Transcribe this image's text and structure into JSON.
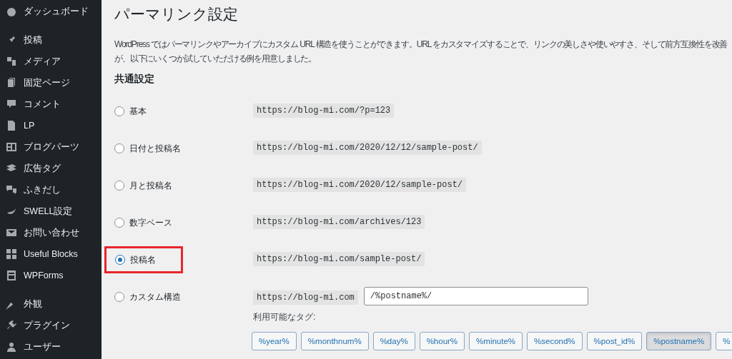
{
  "sidebar": {
    "groups": [
      {
        "items": [
          {
            "label": "ダッシュボード"
          }
        ]
      },
      {
        "items": [
          {
            "label": "投稿"
          },
          {
            "label": "メディア"
          },
          {
            "label": "固定ページ"
          },
          {
            "label": "コメント"
          },
          {
            "label": "LP"
          },
          {
            "label": "ブログパーツ"
          },
          {
            "label": "広告タグ"
          },
          {
            "label": "ふきだし"
          },
          {
            "label": "SWELL設定"
          },
          {
            "label": "お問い合わせ"
          },
          {
            "label": "Useful Blocks"
          },
          {
            "label": "WPForms"
          }
        ]
      },
      {
        "items": [
          {
            "label": "外観"
          },
          {
            "label": "プラグイン"
          },
          {
            "label": "ユーザー"
          }
        ]
      }
    ]
  },
  "page": {
    "title": "パーマリンク設定",
    "description_lines": [
      "WordPress ではパーマリンクやアーカイブにカスタム URL 構造を使うことができます。URL をカスタマイズすることで、リンクの美しさや使いやすさ、そして前方互換性を改善",
      "が、以下にいくつか試していただける例を用意しました。"
    ],
    "section_title": "共通設定",
    "options": [
      {
        "label": "基本",
        "url": "https://blog-mi.com/?p=123",
        "selected": false,
        "highlighted": false,
        "kind": "preset"
      },
      {
        "label": "日付と投稿名",
        "url": "https://blog-mi.com/2020/12/12/sample-post/",
        "selected": false,
        "highlighted": false,
        "kind": "preset"
      },
      {
        "label": "月と投稿名",
        "url": "https://blog-mi.com/2020/12/sample-post/",
        "selected": false,
        "highlighted": false,
        "kind": "preset"
      },
      {
        "label": "数字ベース",
        "url": "https://blog-mi.com/archives/123",
        "selected": false,
        "highlighted": false,
        "kind": "preset"
      },
      {
        "label": "投稿名",
        "url": "https://blog-mi.com/sample-post/",
        "selected": true,
        "highlighted": true,
        "kind": "preset"
      },
      {
        "label": "カスタム構造",
        "url": "https://blog-mi.com",
        "value": "/%postname%/",
        "selected": false,
        "highlighted": false,
        "kind": "custom"
      }
    ],
    "tags_label": "利用可能なタグ:",
    "tags": [
      {
        "label": "%year%",
        "selected": false
      },
      {
        "label": "%monthnum%",
        "selected": false
      },
      {
        "label": "%day%",
        "selected": false
      },
      {
        "label": "%hour%",
        "selected": false
      },
      {
        "label": "%minute%",
        "selected": false
      },
      {
        "label": "%second%",
        "selected": false
      },
      {
        "label": "%post_id%",
        "selected": false
      },
      {
        "label": "%postname%",
        "selected": true
      },
      {
        "label": "%",
        "selected": false
      }
    ]
  }
}
